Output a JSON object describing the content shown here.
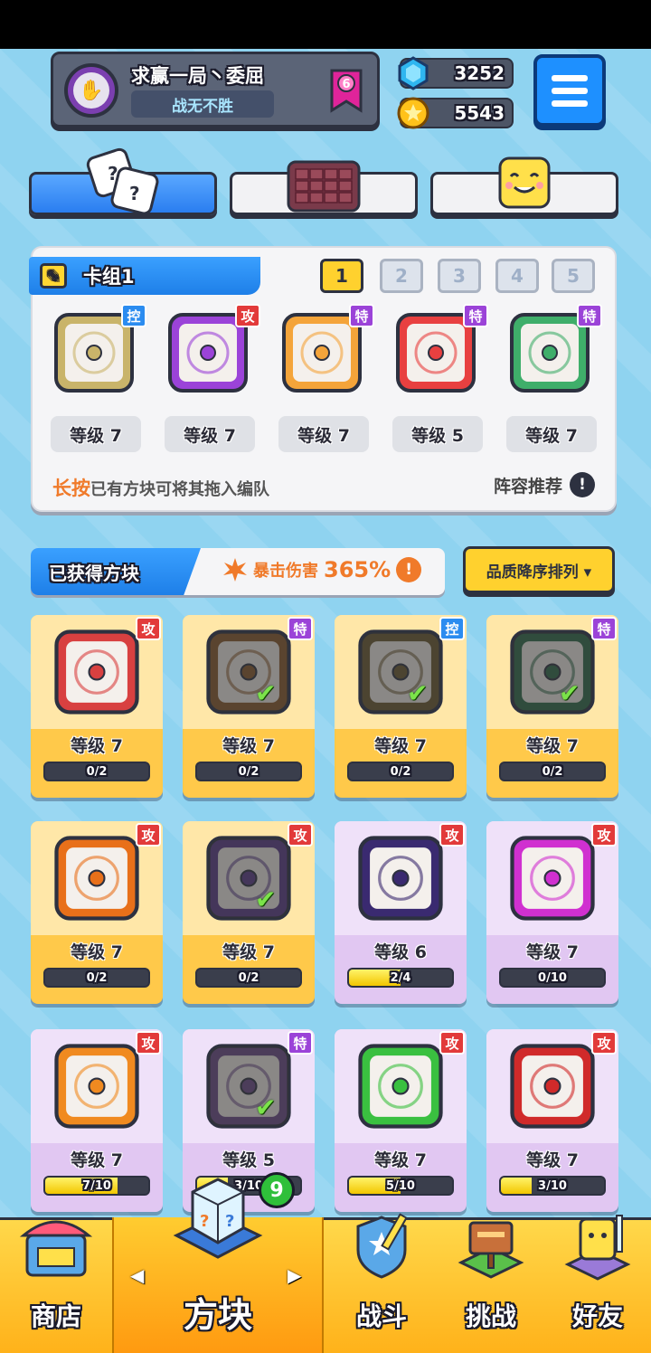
{
  "profile": {
    "name": "求赢一局丶委屈",
    "title": "战无不胜",
    "rank_badge": "6"
  },
  "currency": {
    "gems": "3252",
    "coins": "5543"
  },
  "tabs": [
    {
      "name": "dice-tab"
    },
    {
      "name": "board-tab"
    },
    {
      "name": "emoji-tab"
    }
  ],
  "deck": {
    "label": "卡组1",
    "numbers": [
      "1",
      "2",
      "3",
      "4",
      "5"
    ],
    "active_index": 1,
    "slots": [
      {
        "level": "等级 7",
        "tag": "控",
        "color": "#c9b46a"
      },
      {
        "level": "等级 7",
        "tag": "攻",
        "color": "#9b43d8"
      },
      {
        "level": "等级 7",
        "tag": "特",
        "color": "#f4a43a"
      },
      {
        "level": "等级 5",
        "tag": "特",
        "color": "#e84040"
      },
      {
        "level": "等级 7",
        "tag": "特",
        "color": "#3fae6a"
      }
    ],
    "hint_emph": "长按",
    "hint_text": "已有方块可将其拖入编队",
    "recommend": "阵容推荐"
  },
  "obtained": {
    "label": "已获得方块",
    "crit_label": "暴击伤害",
    "crit_value": "365%",
    "sort_label": "品质降序排列 ▾"
  },
  "cards": [
    {
      "rarity": "legend",
      "level": "等级 7",
      "progress": "0/2",
      "fill": 0,
      "tag": "攻",
      "color": "#d84040",
      "used": false
    },
    {
      "rarity": "legend",
      "level": "等级 7",
      "progress": "0/2",
      "fill": 0,
      "tag": "特",
      "color": "#8a5a2a",
      "used": true
    },
    {
      "rarity": "legend",
      "level": "等级 7",
      "progress": "0/2",
      "fill": 0,
      "tag": "控",
      "color": "#6a5a30",
      "used": true
    },
    {
      "rarity": "legend",
      "level": "等级 7",
      "progress": "0/2",
      "fill": 0,
      "tag": "特",
      "color": "#2d6a4a",
      "used": true
    },
    {
      "rarity": "legend",
      "level": "等级 7",
      "progress": "0/2",
      "fill": 0,
      "tag": "攻",
      "color": "#e8701a",
      "used": false
    },
    {
      "rarity": "legend",
      "level": "等级 7",
      "progress": "0/2",
      "fill": 0,
      "tag": "攻",
      "color": "#5a3a8a",
      "used": true
    },
    {
      "rarity": "epic",
      "level": "等级 6",
      "progress": "2/4",
      "fill": 0.5,
      "tag": "攻",
      "color": "#3a2a70",
      "used": false
    },
    {
      "rarity": "epic",
      "level": "等级 7",
      "progress": "0/10",
      "fill": 0,
      "tag": "攻",
      "color": "#d030d0",
      "used": false
    },
    {
      "rarity": "epic",
      "level": "等级 7",
      "progress": "7/10",
      "fill": 0.7,
      "tag": "攻",
      "color": "#f08a20",
      "used": false
    },
    {
      "rarity": "epic",
      "level": "等级 5",
      "progress": "3/10",
      "fill": 0.3,
      "tag": "特",
      "color": "#6a4a8a",
      "used": true
    },
    {
      "rarity": "epic",
      "level": "等级 7",
      "progress": "5/10",
      "fill": 0.5,
      "tag": "攻",
      "color": "#3ac040",
      "used": false
    },
    {
      "rarity": "epic",
      "level": "等级 7",
      "progress": "3/10",
      "fill": 0.3,
      "tag": "攻",
      "color": "#d02a2a",
      "used": false
    }
  ],
  "nav": {
    "shop": "商店",
    "blocks": "方块",
    "blocks_badge": "9",
    "battle": "战斗",
    "challenge": "挑战",
    "friends": "好友"
  }
}
